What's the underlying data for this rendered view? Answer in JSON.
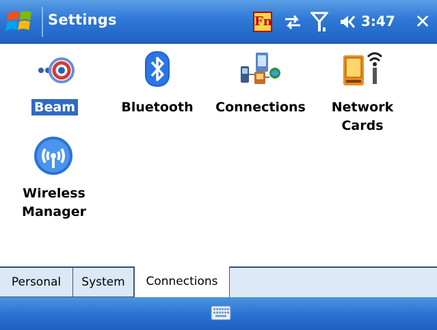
{
  "titlebar": {
    "title": "Settings",
    "fn_label": "Fn",
    "time": "3:47",
    "close_label": "✕",
    "icons": [
      "windows-start-icon",
      "fn-icon",
      "connectivity-icon",
      "signal-icon",
      "volume-icon"
    ]
  },
  "items": [
    {
      "name": "beam",
      "label": "Beam",
      "selected": true,
      "icon": "beam-icon"
    },
    {
      "name": "bluetooth",
      "label": "Bluetooth",
      "selected": false,
      "icon": "bluetooth-icon"
    },
    {
      "name": "connections",
      "label": "Connections",
      "selected": false,
      "icon": "connections-icon"
    },
    {
      "name": "network-cards",
      "label_line1": "Network",
      "label_line2": "Cards",
      "selected": false,
      "icon": "network-card-icon"
    },
    {
      "name": "wireless-manager",
      "label_line1": "Wireless",
      "label_line2": "Manager",
      "selected": false,
      "icon": "wireless-manager-icon"
    }
  ],
  "tabs": [
    {
      "label": "Personal",
      "active": false
    },
    {
      "label": "System",
      "active": false
    },
    {
      "label": "Connections",
      "active": true
    }
  ],
  "menubar": {
    "icon": "keyboard-icon"
  },
  "colors": {
    "titlebar_blue": "#2f78d6",
    "selection_blue": "#316ac5",
    "tab_bg": "#dbe8f6"
  }
}
